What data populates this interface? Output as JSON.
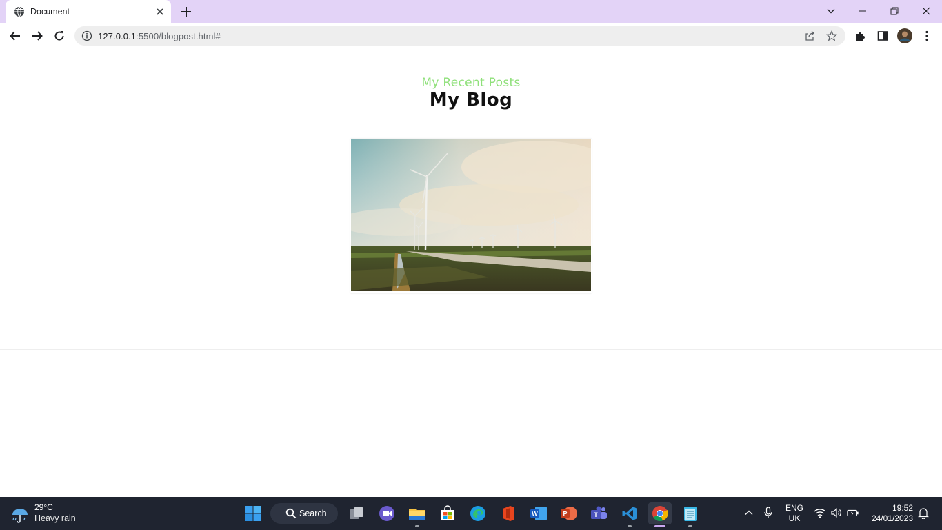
{
  "browser": {
    "tab_title": "Document",
    "url_host": "127.0.0.1",
    "url_rest": ":5500/blogpost.html#",
    "icons": [
      "globe-icon",
      "close-icon",
      "plus-icon",
      "chevron-down-icon",
      "minimize-icon",
      "restore-icon",
      "close-window-icon",
      "back-icon",
      "forward-icon",
      "reload-icon",
      "info-icon",
      "share-icon",
      "star-icon",
      "extensions-icon",
      "side-panel-icon",
      "avatar",
      "menu-icon"
    ]
  },
  "page": {
    "subtitle": "My Recent Posts",
    "heading": "My Blog",
    "image_alt": "Wind turbines in a field",
    "colors": {
      "subtitle": "#8fe07a",
      "heading": "#111111"
    }
  },
  "taskbar": {
    "weather_temp": "29°C",
    "weather_condition": "Heavy rain",
    "search_label": "Search",
    "language_line1": "ENG",
    "language_line2": "UK",
    "time": "19:52",
    "date": "24/01/2023",
    "apps": [
      "start",
      "search",
      "task-view",
      "teams-chat",
      "file-explorer",
      "microsoft-store",
      "edge",
      "office",
      "word",
      "powerpoint",
      "teams",
      "vscode",
      "chrome",
      "notepad"
    ]
  }
}
